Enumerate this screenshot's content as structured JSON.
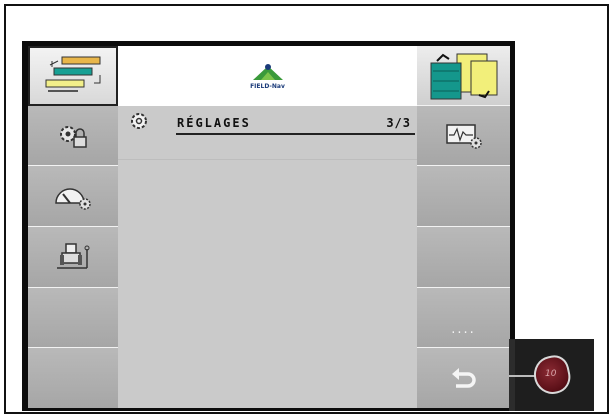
{
  "header": {
    "logo_text": "FIELD-Nav"
  },
  "settings": {
    "title": "RÉGLAGES",
    "page": "3/3"
  },
  "right_panel": {
    "more_label": "...."
  },
  "remote": {
    "button_label": "10"
  },
  "colors": {
    "bezel": "#0c0c0c",
    "panel": "#c9c9c9",
    "teal": "#10968c",
    "yellow": "#f2f07a",
    "remote_red": "#6a1620"
  }
}
